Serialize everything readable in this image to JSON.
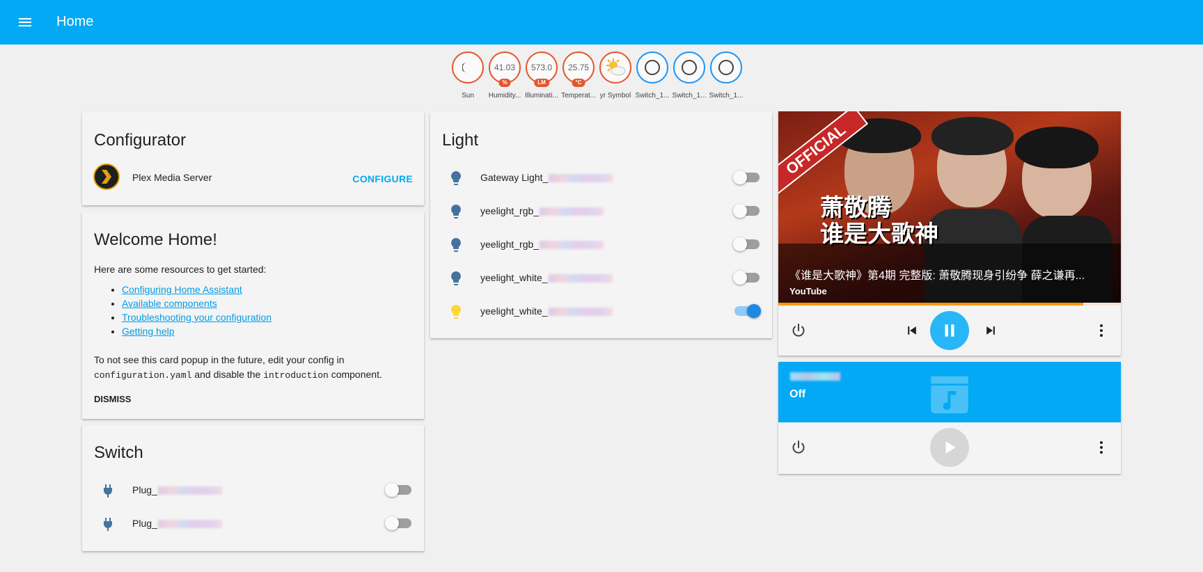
{
  "header": {
    "title": "Home"
  },
  "badges": [
    {
      "value": "",
      "unit": "",
      "label": "Sun",
      "icon": "moon-icon"
    },
    {
      "value": "41.03",
      "unit": "%",
      "label": "Humidity..."
    },
    {
      "value": "573.0",
      "unit": "LM",
      "label": "Illuminati..."
    },
    {
      "value": "25.75",
      "unit": "°C",
      "label": "Temperat..."
    },
    {
      "value": "",
      "unit": "",
      "label": "yr Symbol",
      "icon": "partly-cloudy-icon"
    },
    {
      "value": "",
      "unit": "",
      "label": "Switch_1...",
      "icon": "circle-icon"
    },
    {
      "value": "",
      "unit": "",
      "label": "Switch_1...",
      "icon": "circle-icon"
    },
    {
      "value": "",
      "unit": "",
      "label": "Switch_1...",
      "icon": "circle-icon"
    }
  ],
  "configurator": {
    "title": "Configurator",
    "item_name": "Plex Media Server",
    "action": "CONFIGURE"
  },
  "welcome": {
    "title": "Welcome Home!",
    "intro": "Here are some resources to get started:",
    "links": [
      "Configuring Home Assistant",
      "Available components",
      "Troubleshooting your configuration",
      "Getting help"
    ],
    "note_1": "To not see this card popup in the future, edit your config in",
    "note_code_1": "configuration.yaml",
    "note_2": " and disable the ",
    "note_code_2": "introduction",
    "note_3": " component.",
    "dismiss": "DISMISS"
  },
  "switch_card": {
    "title": "Switch",
    "items": [
      {
        "label": "Plug_",
        "state": "off"
      },
      {
        "label": "Plug_",
        "state": "off"
      }
    ]
  },
  "light_card": {
    "title": "Light",
    "items": [
      {
        "label": "Gateway Light_",
        "state": "off"
      },
      {
        "label": "yeelight_rgb_",
        "state": "off"
      },
      {
        "label": "yeelight_rgb_",
        "state": "off"
      },
      {
        "label": "yeelight_white_",
        "state": "off"
      },
      {
        "label": "yeelight_white_",
        "state": "on"
      }
    ]
  },
  "media_player_1": {
    "title": "《谁是大歌神》第4期 完整版: 萧敬腾现身引纷争 薛之谦再...",
    "source": "YouTube",
    "progress": 0.89,
    "art_badge": "OFFICIAL",
    "art_text_1": "萧敬腾",
    "art_text_2": "谁是大歌神"
  },
  "media_player_2": {
    "state": "Off"
  },
  "colors": {
    "header": "#03a9f4",
    "badge_sensor": "#e4572e",
    "badge_switch": "#2196f3",
    "light_on": "#fdd835",
    "entity_icon": "#44739e",
    "progress": "#ff9800"
  }
}
